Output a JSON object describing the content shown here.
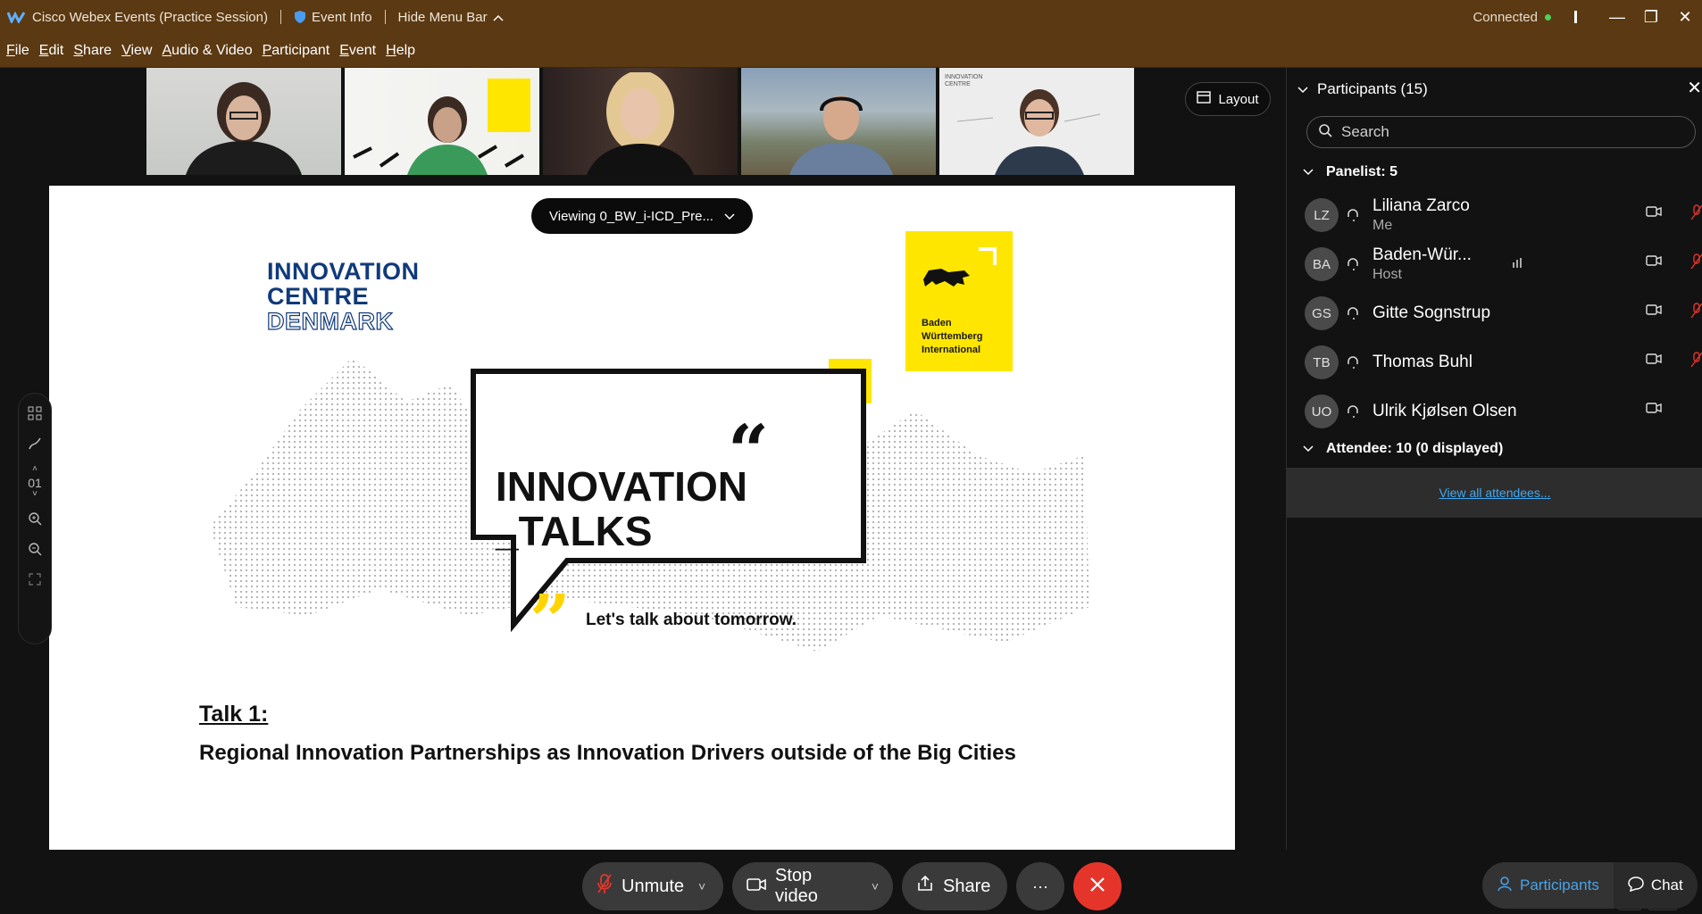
{
  "titlebar": {
    "app_title": "Cisco Webex Events (Practice Session)",
    "event_info": "Event Info",
    "hide_menu": "Hide Menu Bar",
    "status": "Connected"
  },
  "menu": [
    "File",
    "Edit",
    "Share",
    "View",
    "Audio & Video",
    "Participant",
    "Event",
    "Help"
  ],
  "layout_label": "Layout",
  "slide": {
    "viewing_label": "Viewing 0_BW_i-ICD_Pre...",
    "icd_logo": [
      "INNOVATION",
      "CENTRE",
      "DENMARK"
    ],
    "bw_logo": [
      "Baden",
      "Württemberg",
      "International"
    ],
    "talks_title": [
      "INNOVATION",
      "_TALKS"
    ],
    "tagline": "Let's talk about tomorrow.",
    "talk_title": "Talk 1:",
    "talk_subtitle": "Regional Innovation Partnerships as Innovation Drivers outside of the Big Cities"
  },
  "left_toolbar": {
    "page": "01"
  },
  "controls": {
    "unmute": "Unmute",
    "stop_video": "Stop video",
    "share": "Share",
    "more": "···"
  },
  "panel": {
    "title": "Participants (15)",
    "search_placeholder": "Search",
    "panelist_group": "Panelist: 5",
    "attendee_group": "Attendee: 10 (0 displayed)",
    "view_all": "View all attendees...",
    "participants": [
      {
        "initials": "LZ",
        "name": "Liliana Zarco",
        "role": "Me"
      },
      {
        "initials": "BA",
        "name": "Baden-Wür...",
        "role": "Host"
      },
      {
        "initials": "GS",
        "name": "Gitte Sognstrup",
        "role": ""
      },
      {
        "initials": "TB",
        "name": "Thomas Buhl",
        "role": ""
      },
      {
        "initials": "UO",
        "name": "Ulrik Kjølsen Olsen",
        "role": ""
      }
    ]
  },
  "tabs": {
    "participants": "Participants",
    "chat": "Chat"
  },
  "colors": {
    "titlebar": "#5b3912",
    "accent_blue": "#3fa9f5",
    "end_red": "#e5352b",
    "yellow": "#ffe600",
    "icd_blue": "#103a7a"
  }
}
